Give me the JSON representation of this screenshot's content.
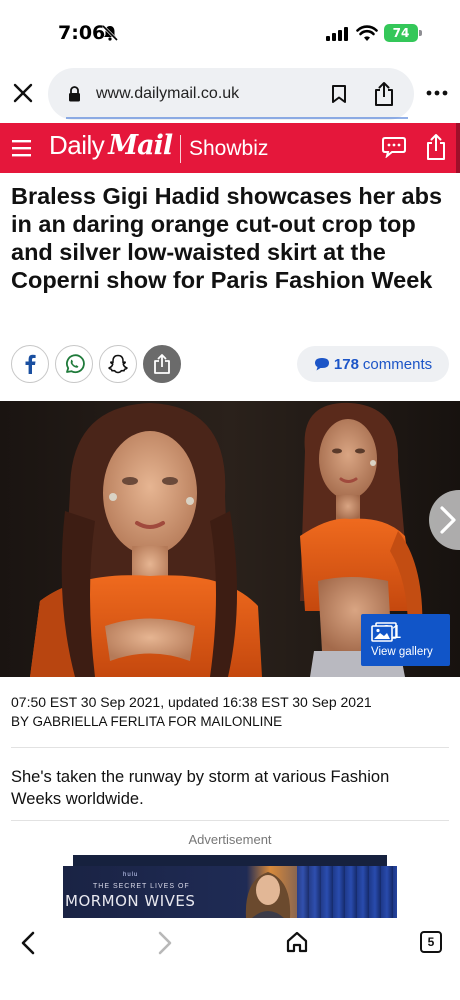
{
  "status_bar": {
    "time": "7:06",
    "battery": "74"
  },
  "browser": {
    "url": "www.dailymail.co.uk",
    "tabs_count": "5"
  },
  "site_header": {
    "logo_daily": "Daily",
    "logo_mail": "Mail",
    "section": "Showbiz",
    "brand_color": "#e5173b"
  },
  "article": {
    "headline": "Braless Gigi Hadid showcases her abs in an daring orange cut-out crop top and silver low-waisted skirt at the Coperni show for Paris Fashion Week",
    "comments_count": "178",
    "comments_label": "comments",
    "gallery_count": "+31",
    "gallery_label": "View gallery",
    "date_line": "07:50 EST 30 Sep 2021, updated 16:38 EST 30 Sep 2021",
    "author_line": "By GABRIELLA FERLITA FOR MAILONLINE",
    "lead": "She's taken the runway by storm at various Fashion Weeks worldwide."
  },
  "ad": {
    "label": "Advertisement",
    "network": "hulu",
    "subtitle": "THE SECRET LIVES OF",
    "title": "MORMON WIVES"
  },
  "icons": {
    "social": [
      "facebook-icon",
      "whatsapp-icon",
      "snapchat-icon",
      "share-icon"
    ],
    "toolbar": [
      "back-icon",
      "forward-icon",
      "home-icon",
      "tabs-icon"
    ]
  },
  "colors": {
    "link_blue": "#1c55c7",
    "gallery_blue": "#1155c8",
    "battery_green": "#34c759"
  }
}
